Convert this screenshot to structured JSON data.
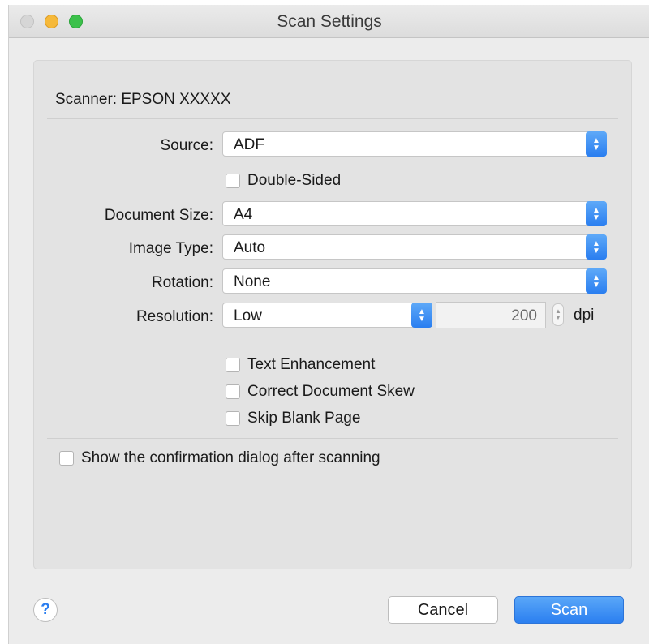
{
  "window": {
    "title": "Scan Settings"
  },
  "scanner": {
    "label": "Scanner: EPSON XXXXX"
  },
  "form": {
    "source": {
      "label": "Source:",
      "value": "ADF"
    },
    "double_sided": {
      "label": "Double-Sided",
      "checked": false
    },
    "document_size": {
      "label": "Document Size:",
      "value": "A4"
    },
    "image_type": {
      "label": "Image Type:",
      "value": "Auto"
    },
    "rotation": {
      "label": "Rotation:",
      "value": "None"
    },
    "resolution": {
      "label": "Resolution:",
      "value": "Low",
      "dpi_value": "200",
      "unit": "dpi"
    },
    "text_enhancement": {
      "label": "Text Enhancement",
      "checked": false
    },
    "correct_skew": {
      "label": "Correct Document Skew",
      "checked": false
    },
    "skip_blank": {
      "label": "Skip Blank Page",
      "checked": false
    }
  },
  "confirmation": {
    "label": "Show the confirmation dialog after scanning",
    "checked": false
  },
  "footer": {
    "help": "?",
    "cancel_label": "Cancel",
    "scan_label": "Scan"
  },
  "colors": {
    "accent": "#2a7ef0",
    "window_bg": "#ececec",
    "panel_bg": "#e3e3e3"
  }
}
